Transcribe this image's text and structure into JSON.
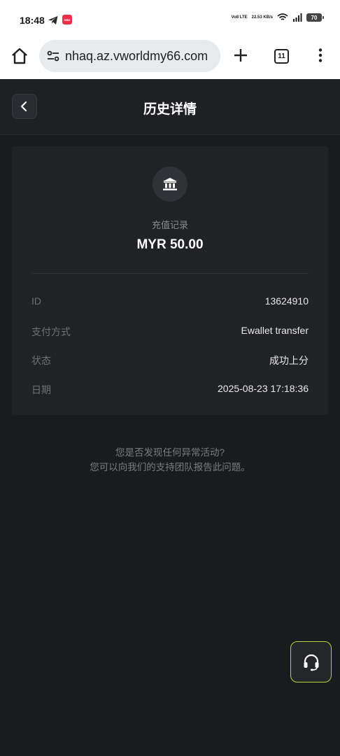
{
  "status_bar": {
    "time": "18:48",
    "app_badge": "HBN",
    "network": "Vo8 LTE",
    "speed": "22.53 KB/s",
    "battery": "70"
  },
  "browser": {
    "url": "nhaq.az.vworldmy66.com",
    "tab_count": "11"
  },
  "header": {
    "title": "历史详情"
  },
  "record": {
    "type_label": "充值记录",
    "amount": "MYR 50.00",
    "rows": [
      {
        "label": "ID",
        "value": "13624910"
      },
      {
        "label": "支付方式",
        "value": "Ewallet transfer"
      },
      {
        "label": "状态",
        "value": "成功上分"
      },
      {
        "label": "日期",
        "value": "2025-08-23 17:18:36"
      }
    ]
  },
  "notice": {
    "line1": "您是否发现任何异常活动?",
    "line2": "您可以向我们的支持团队报告此问题。"
  },
  "colors": {
    "background": "#1a1b1f",
    "card": "#212226",
    "support_border": "#b9d13d"
  },
  "icons": [
    "telegram-icon",
    "home-icon",
    "site-settings-icon",
    "plus-icon",
    "menu-icon",
    "back-icon",
    "bank-icon",
    "headset-icon"
  ]
}
